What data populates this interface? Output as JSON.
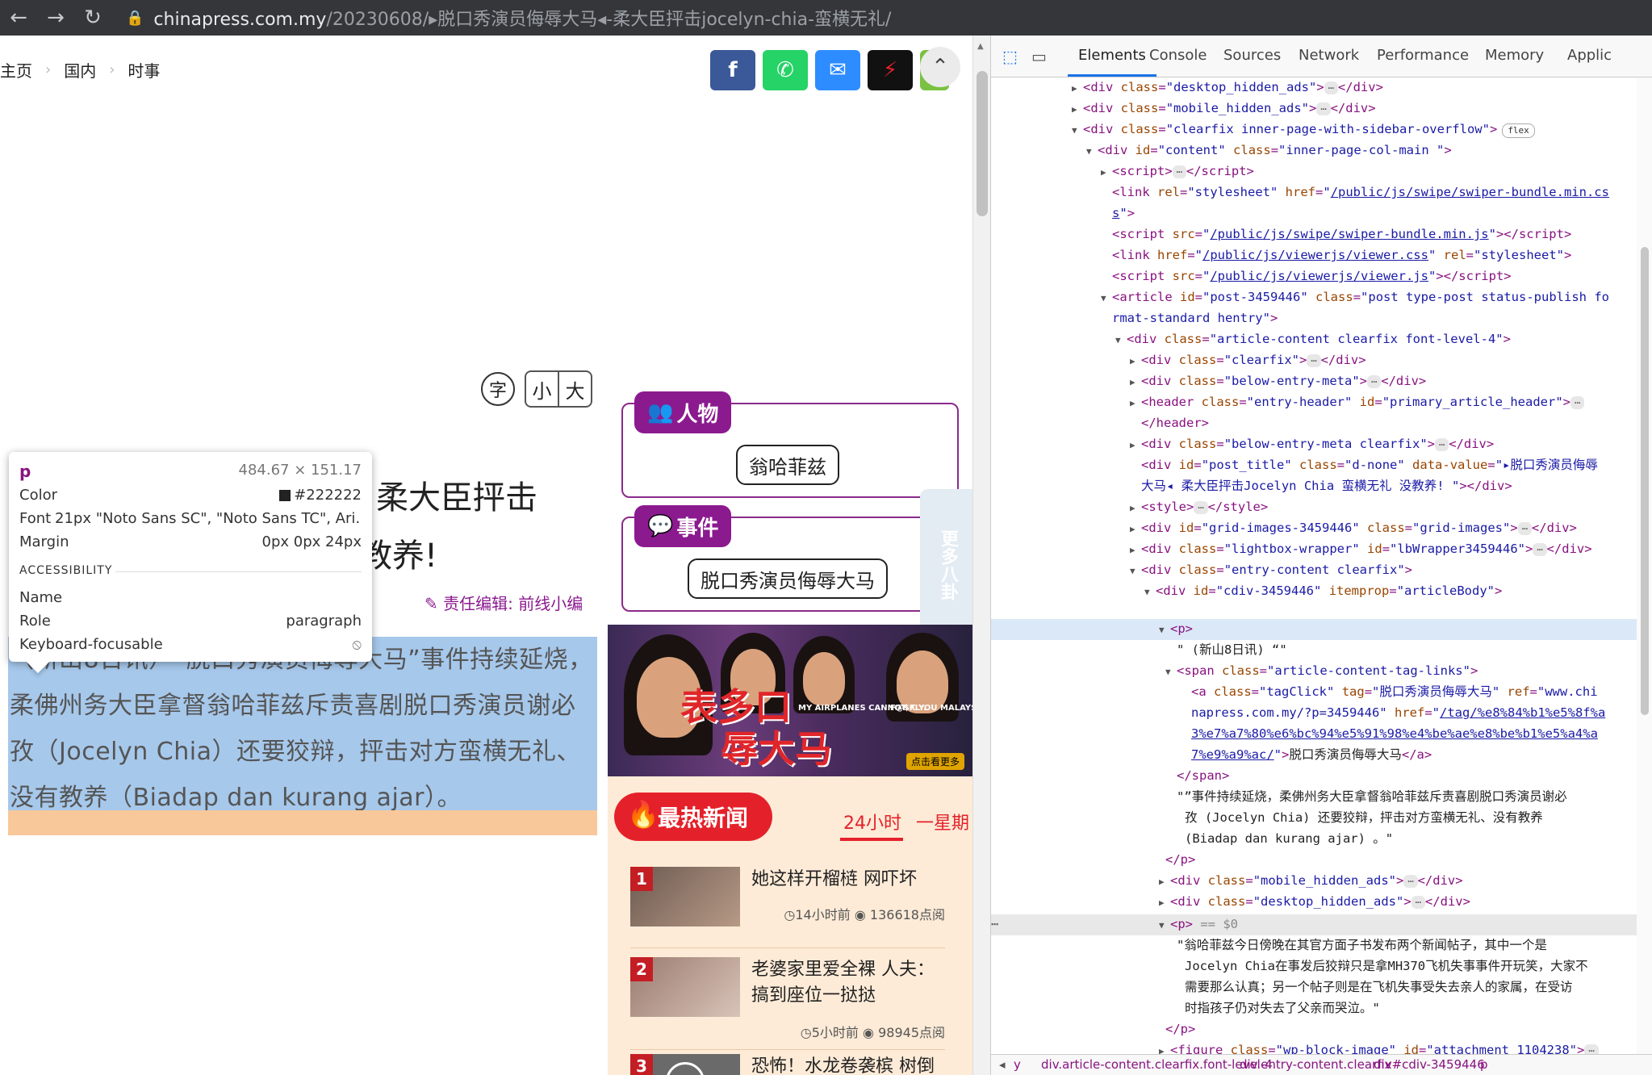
{
  "browser": {
    "url_host": "chinapress.com.my",
    "url_path": "/20230608/▸脱口秀演员侮辱大马◂-柔大臣抨击jocelyn-chia-蛮横无礼/"
  },
  "breadcrumb": [
    "主页",
    "国内",
    "时事"
  ],
  "font_controls": {
    "char": "字",
    "small": "小",
    "large": "大"
  },
  "title_fragments": [
    "柔大臣抨击",
    "教养!"
  ],
  "editor": "✎ 责任编辑: 前线小编",
  "article_body": "（新山8日讯）“脱口秀演员侮辱大马”事件持续延烧，柔佛州务大臣拿督翁哈菲兹斥责喜剧脱口秀演员谢必孜（Jocelyn Chia）还要狡辩，抨击对方蛮横无礼、没有教养（Biadap dan kurang ajar）。",
  "tooltip": {
    "tag": "p",
    "size": "484.67 × 151.17",
    "color_label": "Color",
    "color_value": "#222222",
    "font_label": "Font",
    "font_value": "21px \"Noto Sans SC\", \"Noto Sans TC\", Ari...",
    "margin_label": "Margin",
    "margin_value": "0px 0px 24px",
    "section": "ACCESSIBILITY",
    "name_label": "Name",
    "role_label": "Role",
    "role_value": "paragraph",
    "focus_label": "Keyboard-focusable"
  },
  "sidebar": {
    "people_title": "人物",
    "people_tag": "翁哈菲兹",
    "event_title": "事件",
    "event_tag": "脱口秀演员侮辱大马",
    "side_tab": "更多八卦"
  },
  "banner": {
    "headline_1": "表多口",
    "headline_2": "辱大马",
    "caption_1": "MY AIRPLANES CANNOT FLY.",
    "caption_2": "F@$K YOU MALAYSIA.",
    "more": "点击看更多"
  },
  "hot_news": {
    "title": "最热新闻",
    "tab_24h": "24小时",
    "tab_week": "一星期",
    "items": [
      {
        "rank": "1",
        "title": "她这样开榴梿 网吓坏",
        "time": "14小时前",
        "views": "136618点阅"
      },
      {
        "rank": "2",
        "title": "老婆家里爱全裸 人夫：搞到座位一挞挞",
        "time": "5小时前",
        "views": "98945点阅"
      },
      {
        "rank": "3",
        "title": "恐怖！水龙卷袭槟 树倒砸死摩哆骑士",
        "time": "",
        "views": ""
      }
    ]
  },
  "devtools": {
    "tabs": [
      "Elements",
      "Console",
      "Sources",
      "Network",
      "Performance",
      "Memory",
      "Applic"
    ],
    "breadcrumb_footer": [
      "y",
      "div.article-content.clearfix.font-level-4",
      "div.entry-content.clearfix",
      "div#cdiv-3459446",
      "p"
    ],
    "p_text_1": "\" (新山8日讯) “\"",
    "tag_href_text": "脱口秀演员侮辱大马",
    "p_text_2": "\"”事件持续延烧，柔佛州务大臣拿督翁哈菲兹斥责喜剧脱口秀演员谢必",
    "p_text_3": "孜 (Jocelyn Chia) 还要狡辩，抨击对方蛮横无礼、没有教养",
    "p_text_4": "(Biadap dan kurang ajar) 。\"",
    "p2_text_1": "\"翁哈菲兹今日傍晚在其官方面子书发布两个新闻帖子，其中一个是",
    "p2_text_2": "Jocelyn Chia在事发后狡辩只是拿MH370飞机失事事件开玩笑，大家不",
    "p2_text_3": "需要那么认真；另一个帖子则是在飞机失事受失去亲人的家属，在受访",
    "p2_text_4": "时指孩子仍对失去了父亲而哭泣。\"",
    "post_title_value": "▸脱口秀演员侮辱",
    "post_title_value2": "大马◂ 柔大臣抨击Jocelyn Chia 蛮横无礼 没教养! "
  },
  "colors": {
    "brand_purple": "#8b1a8f",
    "hot_red": "#e4212a",
    "selection_blue": "#a6c8eb",
    "margin_orange": "#f8c89a"
  }
}
